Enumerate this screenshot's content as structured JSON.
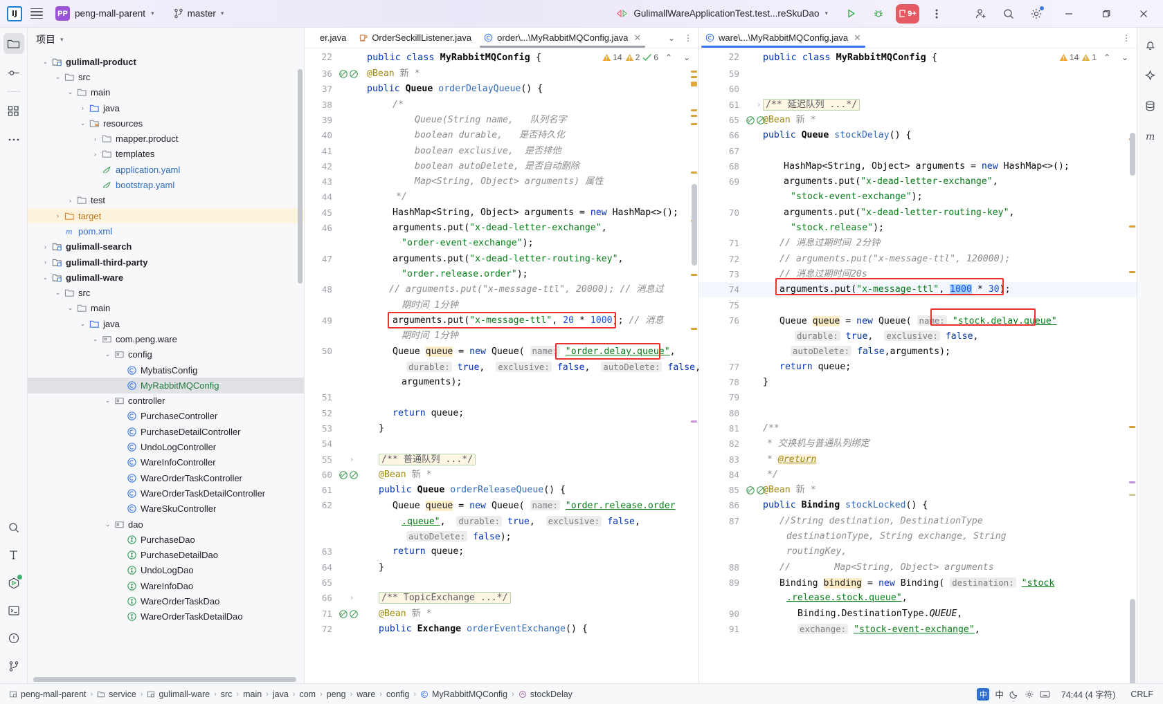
{
  "titlebar": {
    "ide_logo": "intellij-idea-logo",
    "project_badge": "PP",
    "project_name": "peng-mall-parent",
    "branch_icon": "git-branch-icon",
    "branch_name": "master",
    "run_config": "GulimallWareApplicationTest.test...reSkuDao",
    "run_label": "run-icon",
    "debug_label": "debug-icon",
    "run_count_badge": "9+",
    "more_label": "more-options-icon",
    "account_label": "account-icon",
    "search_label": "search-icon",
    "settings_label": "settings-icon",
    "minimize": "minimize-icon",
    "maximize": "maximize-icon",
    "close": "close-icon"
  },
  "rail": {
    "project_icon": "project-folder-icon",
    "commit_icon": "commit-icon",
    "structure_icon": "structure-icon",
    "more_icon": "more-tool-windows-icon",
    "find_icon": "search-everywhere-icon",
    "build_icon": "build-hammer-icon",
    "run_icon": "run-tool-window-icon",
    "terminal_icon": "terminal-icon",
    "problems_icon": "problems-icon",
    "vcs_icon": "version-control-icon"
  },
  "right_rail": {
    "notifications_icon": "notifications-bell-icon",
    "ai_icon": "ai-assistant-icon",
    "database_icon": "database-icon",
    "maven_icon": "maven-icon"
  },
  "project": {
    "title": "项目",
    "tree": [
      {
        "depth": 2,
        "twist": "v",
        "icon": "module",
        "label": "gulimall-product",
        "style": "mod"
      },
      {
        "depth": 3,
        "twist": "v",
        "icon": "folder",
        "label": "src",
        "style": ""
      },
      {
        "depth": 4,
        "twist": "v",
        "icon": "folder",
        "label": "main",
        "style": ""
      },
      {
        "depth": 5,
        "twist": ">",
        "icon": "source-folder",
        "label": "java",
        "style": ""
      },
      {
        "depth": 5,
        "twist": "v",
        "icon": "resource-folder",
        "label": "resources",
        "style": ""
      },
      {
        "depth": 6,
        "twist": ">",
        "icon": "folder",
        "label": "mapper.product",
        "style": ""
      },
      {
        "depth": 6,
        "twist": ">",
        "icon": "folder",
        "label": "templates",
        "style": ""
      },
      {
        "depth": 6,
        "twist": "",
        "icon": "yaml",
        "label": "application.yaml",
        "style": "blue"
      },
      {
        "depth": 6,
        "twist": "",
        "icon": "yaml",
        "label": "bootstrap.yaml",
        "style": "blue"
      },
      {
        "depth": 4,
        "twist": ">",
        "icon": "folder",
        "label": "test",
        "style": ""
      },
      {
        "depth": 3,
        "twist": ">",
        "icon": "folder-orange",
        "label": "target",
        "style": "orange",
        "row": "highlight"
      },
      {
        "depth": 3,
        "twist": "",
        "icon": "maven-m",
        "label": "pom.xml",
        "style": "blue"
      },
      {
        "depth": 2,
        "twist": ">",
        "icon": "module",
        "label": "gulimall-search",
        "style": "mod"
      },
      {
        "depth": 2,
        "twist": ">",
        "icon": "module",
        "label": "gulimall-third-party",
        "style": "mod"
      },
      {
        "depth": 2,
        "twist": "v",
        "icon": "module",
        "label": "gulimall-ware",
        "style": "mod"
      },
      {
        "depth": 3,
        "twist": "v",
        "icon": "folder",
        "label": "src",
        "style": ""
      },
      {
        "depth": 4,
        "twist": "v",
        "icon": "folder",
        "label": "main",
        "style": ""
      },
      {
        "depth": 5,
        "twist": "v",
        "icon": "source-folder",
        "label": "java",
        "style": ""
      },
      {
        "depth": 6,
        "twist": "v",
        "icon": "package",
        "label": "com.peng.ware",
        "style": ""
      },
      {
        "depth": 7,
        "twist": "v",
        "icon": "package",
        "label": "config",
        "style": ""
      },
      {
        "depth": 8,
        "twist": "",
        "icon": "class",
        "label": "MybatisConfig",
        "style": ""
      },
      {
        "depth": 8,
        "twist": "",
        "icon": "class",
        "label": "MyRabbitMQConfig",
        "style": "green",
        "row": "selected"
      },
      {
        "depth": 7,
        "twist": "v",
        "icon": "package",
        "label": "controller",
        "style": ""
      },
      {
        "depth": 8,
        "twist": "",
        "icon": "class",
        "label": "PurchaseController",
        "style": ""
      },
      {
        "depth": 8,
        "twist": "",
        "icon": "class",
        "label": "PurchaseDetailController",
        "style": ""
      },
      {
        "depth": 8,
        "twist": "",
        "icon": "class",
        "label": "UndoLogController",
        "style": ""
      },
      {
        "depth": 8,
        "twist": "",
        "icon": "class",
        "label": "WareInfoController",
        "style": ""
      },
      {
        "depth": 8,
        "twist": "",
        "icon": "class",
        "label": "WareOrderTaskController",
        "style": ""
      },
      {
        "depth": 8,
        "twist": "",
        "icon": "class",
        "label": "WareOrderTaskDetailController",
        "style": ""
      },
      {
        "depth": 8,
        "twist": "",
        "icon": "class",
        "label": "WareSkuController",
        "style": ""
      },
      {
        "depth": 7,
        "twist": "v",
        "icon": "package",
        "label": "dao",
        "style": ""
      },
      {
        "depth": 8,
        "twist": "",
        "icon": "interface",
        "label": "PurchaseDao",
        "style": ""
      },
      {
        "depth": 8,
        "twist": "",
        "icon": "interface",
        "label": "PurchaseDetailDao",
        "style": ""
      },
      {
        "depth": 8,
        "twist": "",
        "icon": "interface",
        "label": "UndoLogDao",
        "style": ""
      },
      {
        "depth": 8,
        "twist": "",
        "icon": "interface",
        "label": "WareInfoDao",
        "style": ""
      },
      {
        "depth": 8,
        "twist": "",
        "icon": "interface",
        "label": "WareOrderTaskDao",
        "style": ""
      },
      {
        "depth": 8,
        "twist": "",
        "icon": "interface",
        "label": "WareOrderTaskDetailDao",
        "style": ""
      }
    ]
  },
  "left_pane": {
    "tabs": [
      {
        "label": "er.java",
        "icon": "",
        "active": false,
        "partial": true
      },
      {
        "label": "OrderSeckillListener.java",
        "icon": "listener-icon",
        "active": false
      },
      {
        "label": "order\\...\\MyRabbitMQConfig.java",
        "icon": "class-icon",
        "active": true,
        "closable": true
      }
    ],
    "class_line": {
      "num": "22",
      "code": "public class MyRabbitMQConfig {"
    },
    "inspections": {
      "warnings": "14",
      "weak_warnings": "2",
      "checks": "6"
    },
    "lines": [
      {
        "num": "36",
        "marks": "bean-gutter",
        "kind": "anno",
        "text": "@Bean 新 *"
      },
      {
        "num": "37",
        "text": "public Queue orderDelayQueue() {"
      },
      {
        "num": "38",
        "text": "/*"
      },
      {
        "num": "39",
        "text": "Queue(String name,  队列名字"
      },
      {
        "num": "40",
        "text": "boolean durable,  是否持久化"
      },
      {
        "num": "41",
        "text": "boolean exclusive,  是否排他"
      },
      {
        "num": "42",
        "text": "boolean autoDelete, 是否自动删除"
      },
      {
        "num": "43",
        "text": "Map<String, Object> arguments) 属性"
      },
      {
        "num": "44",
        "text": "*/"
      },
      {
        "num": "45",
        "text": "HashMap<String, Object> arguments = new HashMap<>();"
      },
      {
        "num": "46",
        "text": "arguments.put(\"x-dead-letter-exchange\", \"order-event-exchange\");"
      },
      {
        "num": "47",
        "text": "arguments.put(\"x-dead-letter-routing-key\", \"order.release.order\");"
      },
      {
        "num": "48",
        "text": "// arguments.put(\"x-message-ttl\", 20000); // 消息过期时间 1分钟"
      },
      {
        "num": "49",
        "text": "arguments.put(\"x-message-ttl\", 20 * 1000); // 消息过期时间 1分钟",
        "boxed": true
      },
      {
        "num": "50",
        "text": "Queue queue = new Queue( name: \"order.delay.queue\", durable: true, exclusive: false, autoDelete: false, arguments);"
      },
      {
        "num": "51",
        "text": ""
      },
      {
        "num": "52",
        "text": "return queue;"
      },
      {
        "num": "53",
        "text": "}"
      },
      {
        "num": "54",
        "text": ""
      },
      {
        "num": "55",
        "text": "/** 普通队列 ...*/",
        "fold": true
      },
      {
        "num": "60",
        "marks": "bean-gutter",
        "text": "@Bean 新 *"
      },
      {
        "num": "61",
        "text": "public Queue orderReleaseQueue() {"
      },
      {
        "num": "62",
        "text": "Queue queue = new Queue( name: \"order.release.order.queue\", durable: true, exclusive: false, autoDelete: false);"
      },
      {
        "num": "63",
        "text": "return queue;"
      },
      {
        "num": "64",
        "text": "}"
      },
      {
        "num": "65",
        "text": ""
      },
      {
        "num": "66",
        "text": "/** TopicExchange ...*/",
        "fold": true
      },
      {
        "num": "71",
        "marks": "bean-gutter",
        "text": "@Bean 新 *"
      },
      {
        "num": "72",
        "text": "public Exchange orderEventExchange() {"
      }
    ]
  },
  "right_pane": {
    "tabs": [
      {
        "label": "ware\\...\\MyRabbitMQConfig.java",
        "icon": "class-icon",
        "active": true,
        "closable": true
      }
    ],
    "class_line": {
      "num": "22",
      "code": "public class MyRabbitMQConfig {"
    },
    "inspections": {
      "warnings": "14",
      "weak_warnings": "1"
    },
    "lines": [
      {
        "num": "59",
        "text": ""
      },
      {
        "num": "60",
        "text": ""
      },
      {
        "num": "61",
        "text": "/** 延迟队列 ...*/",
        "fold": true
      },
      {
        "num": "65",
        "marks": "bean-gutter",
        "text": "@Bean 新 *"
      },
      {
        "num": "66",
        "text": "public Queue stockDelay() {"
      },
      {
        "num": "67",
        "text": ""
      },
      {
        "num": "68",
        "text": "HashMap<String, Object> arguments = new HashMap<>();"
      },
      {
        "num": "69",
        "text": "arguments.put(\"x-dead-letter-exchange\", \"stock-event-exchange\");"
      },
      {
        "num": "70",
        "text": "arguments.put(\"x-dead-letter-routing-key\", \"stock.release\");"
      },
      {
        "num": "71",
        "text": "// 消息过期时间 2分钟"
      },
      {
        "num": "72",
        "text": "// arguments.put(\"x-message-ttl\", 120000);"
      },
      {
        "num": "73",
        "text": "// 消息过期时间20s"
      },
      {
        "num": "74",
        "text": "arguments.put(\"x-message-ttl\", 1000 * 30);",
        "boxed": true,
        "current": true
      },
      {
        "num": "75",
        "text": ""
      },
      {
        "num": "76",
        "text": "Queue queue = new Queue( name: \"stock.delay.queue\", durable: true, exclusive: false, autoDelete: false,arguments);"
      },
      {
        "num": "77",
        "text": "return queue;"
      },
      {
        "num": "78",
        "text": "}"
      },
      {
        "num": "79",
        "text": ""
      },
      {
        "num": "80",
        "text": ""
      },
      {
        "num": "81",
        "text": "/**"
      },
      {
        "num": "82",
        "text": "* 交换机与普通队列绑定"
      },
      {
        "num": "83",
        "text": "* @return"
      },
      {
        "num": "84",
        "text": "*/"
      },
      {
        "num": "85",
        "marks": "bean-gutter",
        "text": "@Bean 新 *"
      },
      {
        "num": "86",
        "text": "public Binding stockLocked() {"
      },
      {
        "num": "87",
        "text": "//String destination, DestinationType destinationType, String exchange, String routingKey,"
      },
      {
        "num": "88",
        "text": "//        Map<String, Object> arguments"
      },
      {
        "num": "89",
        "text": "Binding binding = new Binding( destination: \"stock.release.stock.queue\","
      },
      {
        "num": "90",
        "text": "Binding.DestinationType.QUEUE,"
      },
      {
        "num": "91",
        "text": "exchange: \"stock-event-exchange\","
      }
    ]
  },
  "statusbar": {
    "breadcrumbs": [
      {
        "icon": "module-icon",
        "label": "peng-mall-parent"
      },
      {
        "icon": "folder-icon",
        "label": "service"
      },
      {
        "icon": "module-icon",
        "label": "gulimall-ware"
      },
      {
        "icon": "",
        "label": "src"
      },
      {
        "icon": "",
        "label": "main"
      },
      {
        "icon": "",
        "label": "java"
      },
      {
        "icon": "",
        "label": "com"
      },
      {
        "icon": "",
        "label": "peng"
      },
      {
        "icon": "",
        "label": "ware"
      },
      {
        "icon": "",
        "label": "config"
      },
      {
        "icon": "class-icon",
        "label": "MyRabbitMQConfig"
      },
      {
        "icon": "method-icon",
        "label": "stockDelay"
      }
    ],
    "caret": "74:44 (4 字符)",
    "line_separator": "CRLF",
    "ime_lang": "中",
    "ime_extra": "中"
  },
  "colors": {
    "accent": "#3573f0",
    "red_box": "#e8302f",
    "keyword": "#0033b3",
    "string": "#067d17",
    "comment": "#8c8c8c",
    "number": "#1750eb",
    "annotation": "#9e880d"
  }
}
